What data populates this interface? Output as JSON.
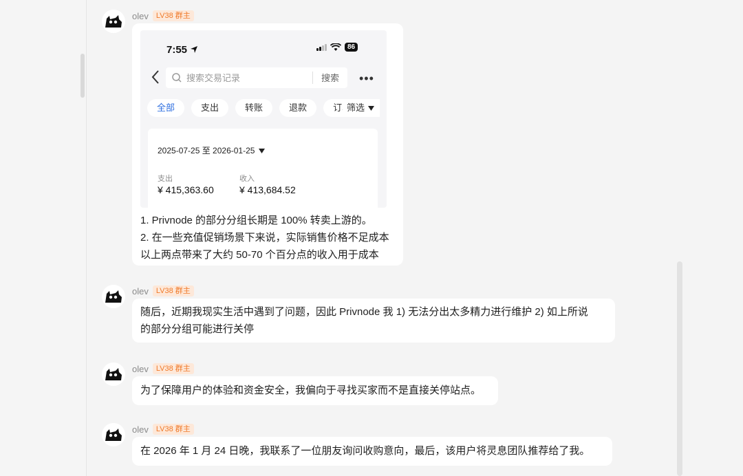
{
  "messages": [
    {
      "name": "olev",
      "badge": "LV38 群主",
      "screenshot": {
        "time": "7:55",
        "battery": "86",
        "search_placeholder": "搜索交易记录",
        "search_button": "搜索",
        "more": "•••",
        "tabs": [
          "全部",
          "支出",
          "转账",
          "退款",
          "订单"
        ],
        "filter": "筛选",
        "date_range": "2025-07-25 至 2026-01-25",
        "expense_label": "支出",
        "expense_value": "¥ 415,363.60",
        "income_label": "收入",
        "income_value": "¥ 413,684.52"
      },
      "lines": [
        "1. Privnode 的部分分组长期是 100% 转卖上游的。",
        "2. 在一些充值促销场景下来说，实际销售价格不足成本",
        "以上两点带来了大约 50-70 个百分点的收入用于成本"
      ]
    },
    {
      "name": "olev",
      "badge": "LV38 群主",
      "lines": [
        "随后，近期我现实生活中遇到了问题，因此 Privnode 我 1) 无法分出太多精力进行维护 2) 如上所说",
        "的部分分组可能进行关停"
      ]
    },
    {
      "name": "olev",
      "badge": "LV38 群主",
      "lines": [
        "为了保障用户的体验和资金安全，我偏向于寻找买家而不是直接关停站点。"
      ]
    },
    {
      "name": "olev",
      "badge": "LV38 群主",
      "lines": [
        "在 2026 年 1 月 24 日晚，我联系了一位朋友询问收购意向，最后，该用户将灵息团队推荐给了我。"
      ]
    }
  ]
}
